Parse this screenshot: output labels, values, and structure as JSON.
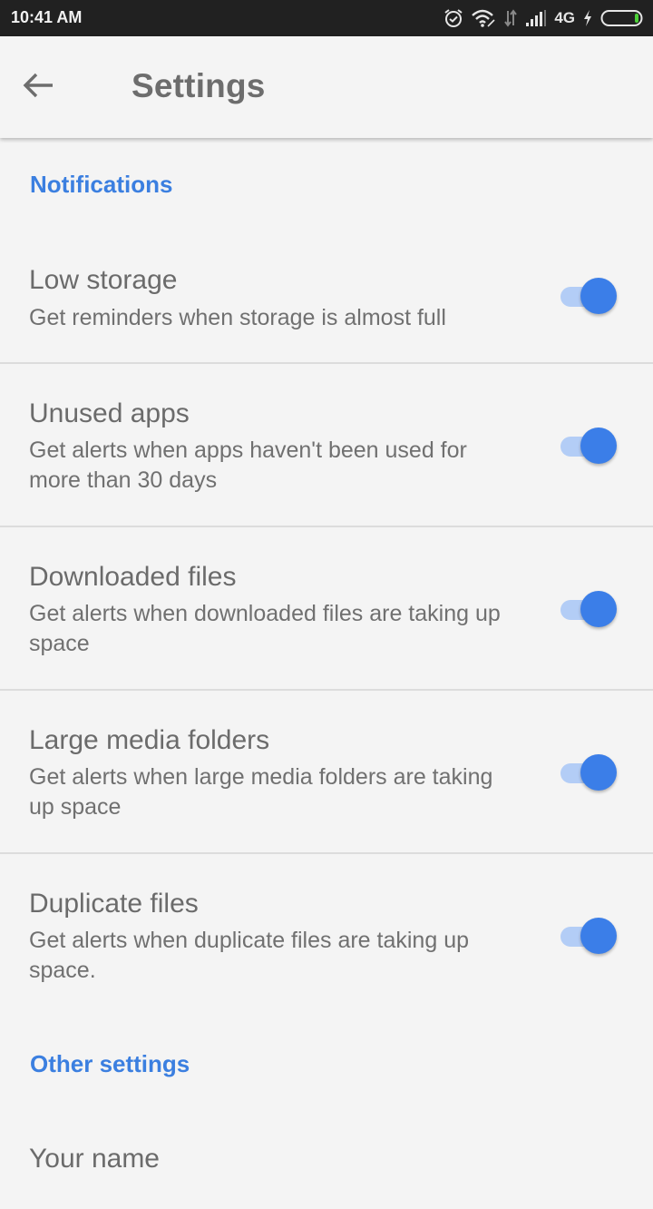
{
  "status_bar": {
    "time": "10:41 AM",
    "network": "4G",
    "icons": [
      "alarm-icon",
      "wifi-icon",
      "data-transfer-icon",
      "signal-icon",
      "charging-icon",
      "battery-icon"
    ]
  },
  "app_bar": {
    "back_icon": "arrow-left-icon",
    "title": "Settings"
  },
  "sections": [
    {
      "header": "Notifications",
      "items": [
        {
          "title": "Low storage",
          "subtitle": "Get reminders when storage is almost full",
          "enabled": true
        },
        {
          "title": "Unused apps",
          "subtitle": "Get alerts when apps haven't been used for more than 30 days",
          "enabled": true
        },
        {
          "title": "Downloaded files",
          "subtitle": "Get alerts when downloaded files are taking up space",
          "enabled": true
        },
        {
          "title": "Large media folders",
          "subtitle": "Get alerts when large media folders are taking up space",
          "enabled": true
        },
        {
          "title": "Duplicate files",
          "subtitle": "Get alerts when duplicate files are taking up space.",
          "enabled": true
        }
      ]
    },
    {
      "header": "Other settings",
      "items": [
        {
          "title": "Your name"
        }
      ]
    }
  ],
  "colors": {
    "accent": "#3b7fe0",
    "switch_thumb": "#3b7ee8",
    "switch_track": "#b3cdf6",
    "background": "#f4f4f4",
    "status_bar": "#212121"
  }
}
